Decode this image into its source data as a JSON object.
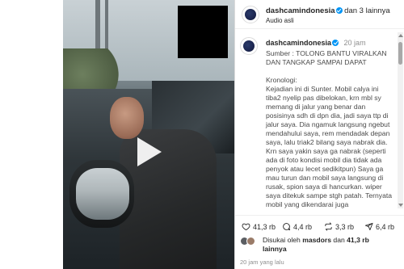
{
  "header": {
    "username": "dashcamindonesia",
    "collab_text": "dan 3 lainnya",
    "audio_label": "Audio asli"
  },
  "caption": {
    "username": "dashcamindonesia",
    "time": "20 jam",
    "text": "Sumber : TOLONG BANTU VIRALKAN DAN TANGKAP SAMPAI DAPAT\n\nKronologi:\nKejadian ini di Sunter. Mobil calya ini tiba2 nyelip pas dibelokan, krn mbl sy memang di jalur yang benar dan posisinya sdh di dpn dia, jadi saya ttp di jalur saya. Dia ngamuk langsung ngebut mendahului saya, rem mendadak depan saya, lalu triak2 bilang saya nabrak dia. Krn saya yakin saya ga nabrak (seperti ada di foto kondisi mobil dia tidak ada penyok atau lecet sedikitpun) Saya ga mau turun dan mobil saya langsung di rusak, spion saya di hancurkan. wiper saya ditekuk sampe stgh patah. Ternyata mobil yang dikendarai juga"
  },
  "actions": {
    "likes_count": "41,3 rb",
    "comments_count": "4,4 rb",
    "reposts_count": "3,3 rb",
    "shares_count": "6,4 rb"
  },
  "likes": {
    "prefix": "Disukai oleh",
    "user": "masdors",
    "middle": "dan",
    "count": "41,3 rb",
    "suffix": "lainnya"
  },
  "post_time": "20 jam yang lalu",
  "colors": {
    "verified": "#0095f6",
    "text": "#262626",
    "muted": "#8e8e8e"
  }
}
